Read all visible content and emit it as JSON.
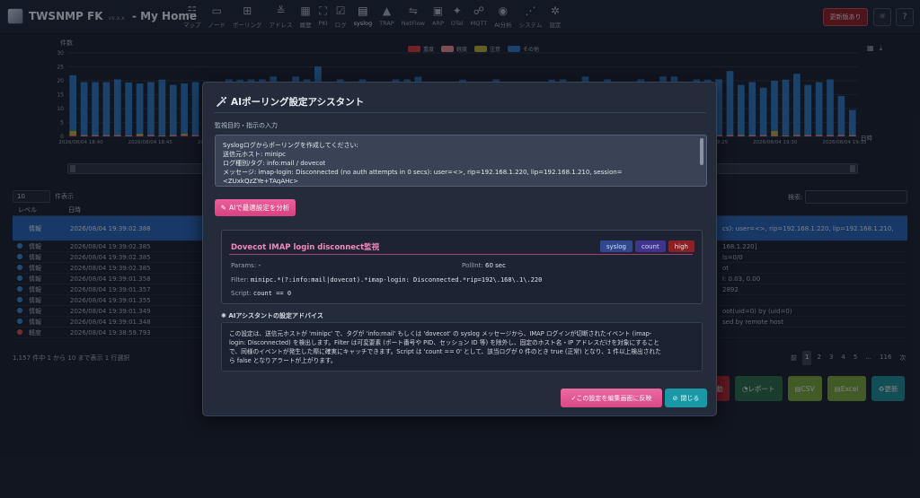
{
  "app": {
    "title": "TWSNMP FK",
    "version": "vx.x.x",
    "page": "- My Home"
  },
  "nav": [
    {
      "icon": "☷",
      "label": "マップ"
    },
    {
      "icon": "▭",
      "label": "ノード"
    },
    {
      "icon": "⊞",
      "label": "ポーリング"
    },
    {
      "icon": "≚",
      "label": "アドレス"
    },
    {
      "icon": "▦",
      "label": "履歴"
    },
    {
      "icon": "⛶",
      "label": "PKI"
    },
    {
      "icon": "☑",
      "label": "ログ"
    },
    {
      "icon": "▤",
      "label": "syslog"
    },
    {
      "icon": "▲",
      "label": "TRAP"
    },
    {
      "icon": "⇋",
      "label": "NetFlow"
    },
    {
      "icon": "▣",
      "label": "ARP"
    },
    {
      "icon": "✦",
      "label": "OTel"
    },
    {
      "icon": "☍",
      "label": "MQTT"
    },
    {
      "icon": "◉",
      "label": "AI分析"
    },
    {
      "icon": "⋰",
      "label": "システム"
    },
    {
      "icon": "✲",
      "label": "設定"
    }
  ],
  "header": {
    "update_label": "更新版あり",
    "theme_icon": "☼",
    "help_icon": "?"
  },
  "chart_data": {
    "type": "bar",
    "ylabel": "件数",
    "xlabel": "日時",
    "ylim": [
      0,
      30
    ],
    "yticks": [
      0,
      5,
      10,
      15,
      20,
      25,
      30
    ],
    "stacked": true,
    "legend": [
      "重度",
      "軽度",
      "注意",
      "その他"
    ],
    "legend_colors": [
      "#d9363e",
      "#e88a92",
      "#b6b035",
      "#2f78c0"
    ],
    "x_tick_labels": [
      "2026/08/04 18:40",
      "2026/08/04 18:45",
      "2026/08/04 18:50",
      "2026/08/04 18:55",
      "2026/08/04 19:00",
      "2026/08/04 19:05",
      "2026/08/04 19:10",
      "2026/08/04 19:15",
      "2026/08/04 19:20",
      "2026/08/04 19:25",
      "2026/08/04 19:30",
      "2026/08/04 19:35"
    ],
    "series": [
      {
        "name": "重度",
        "values": [
          0.2,
          0,
          0,
          0,
          0,
          0,
          0,
          0,
          0,
          0,
          0.2,
          0,
          0,
          0,
          0,
          0,
          0,
          0,
          0,
          0,
          0,
          0,
          0.2,
          0,
          0,
          0,
          0,
          0,
          0,
          0,
          0,
          0,
          0,
          0,
          0,
          0,
          0,
          0,
          0,
          0,
          0,
          0,
          0,
          0,
          0,
          0,
          0,
          0,
          0,
          0,
          0,
          0,
          0,
          0,
          0,
          0,
          0,
          0,
          0,
          0,
          0,
          0,
          0,
          0,
          0,
          0,
          0,
          0,
          0,
          0,
          0
        ]
      },
      {
        "name": "軽度",
        "values": [
          0.3,
          0.5,
          0.5,
          0.5,
          0.5,
          0.4,
          0.5,
          0.5,
          0.4,
          0.5,
          0.3,
          0.5,
          0.5,
          0.4,
          0.5,
          0.4,
          0.5,
          0.5,
          0.5,
          0.5,
          0.5,
          0.5,
          0.4,
          0.5,
          0.5,
          0.4,
          0.5,
          0.5,
          0.4,
          0.5,
          0.5,
          0.4,
          0.5,
          0.5,
          0.5,
          0.4,
          0.5,
          0.5,
          0.5,
          0.4,
          0.5,
          0.5,
          0.5,
          0.4,
          0.5,
          0.5,
          0.5,
          0.4,
          0.5,
          0.5,
          0.5,
          0.5,
          0.4,
          0.5,
          0.5,
          0.5,
          0.5,
          0.4,
          0.5,
          0.5,
          0.5,
          0.5,
          0.5,
          0.5,
          0.4,
          0.5,
          0.5,
          0.5,
          0.5,
          0.5,
          0.5
        ]
      },
      {
        "name": "注意",
        "values": [
          1.5,
          0,
          0,
          0,
          0,
          0,
          0.5,
          0,
          0,
          0,
          0.5,
          0,
          0,
          0,
          0,
          0,
          0,
          0,
          0,
          0,
          0,
          0,
          0.5,
          0,
          0,
          0,
          0,
          0,
          0,
          0,
          0,
          0,
          0,
          0,
          0,
          0,
          0,
          0,
          0,
          0,
          0,
          0,
          0,
          0,
          0,
          0,
          0,
          0,
          0,
          0,
          0,
          0,
          0,
          0,
          0,
          0,
          0,
          0,
          0,
          0,
          0,
          0,
          0,
          1.5,
          0,
          0,
          0,
          0,
          0,
          0,
          0
        ]
      },
      {
        "name": "その他",
        "values": [
          20,
          19,
          19,
          19,
          20,
          19,
          18,
          19,
          20,
          18,
          18,
          19,
          19,
          18,
          20,
          20,
          20,
          20,
          21,
          19,
          21,
          20,
          24,
          18,
          20,
          18,
          20,
          18,
          18,
          20,
          20,
          21,
          19,
          18,
          19,
          20,
          19,
          18,
          20,
          17,
          18,
          18,
          18,
          20,
          20,
          17,
          21,
          19,
          20,
          18,
          19,
          20,
          19,
          21,
          21,
          19,
          20,
          20,
          20,
          23,
          18,
          19,
          17,
          18,
          20,
          22,
          18,
          19,
          20,
          14,
          9
        ]
      }
    ]
  },
  "chart_tools": {
    "zoom_icon": "▦",
    "download_icon": "⤓"
  },
  "table": {
    "page_size": "10",
    "page_size_suffix": "件表示",
    "search_label": "検索:",
    "headers": {
      "level": "レベル",
      "time": "日時"
    },
    "rows": [
      {
        "level": "情報",
        "time": "2026/08/04 19:39:02.388",
        "right": "cs): user=<>, rip=192.168.1.220, lip=192.168.1.210,",
        "type": "info"
      },
      {
        "level": "情報",
        "time": "2026/08/04 19:39:02.385",
        "right": "168.1.220]",
        "type": "info"
      },
      {
        "level": "情報",
        "time": "2026/08/04 19:39:02.385",
        "right": "ls=0/0",
        "type": "info"
      },
      {
        "level": "情報",
        "time": "2026/08/04 19:39:02.385",
        "right": "ot",
        "type": "info"
      },
      {
        "level": "情報",
        "time": "2026/08/04 19:39:01.358",
        "right": "l: 0.03, 0.00",
        "type": "info"
      },
      {
        "level": "情報",
        "time": "2026/08/04 19:39:01.357",
        "right": "2892",
        "type": "info"
      },
      {
        "level": "情報",
        "time": "2026/08/04 19:39:01.355",
        "right": "",
        "type": "info"
      },
      {
        "level": "情報",
        "time": "2026/08/04 19:39:01.349",
        "right": "oot(uid=0) by (uid=0)",
        "type": "info"
      },
      {
        "level": "情報",
        "time": "2026/08/04 19:39:01.348",
        "right": "sed by remote host",
        "type": "info"
      },
      {
        "level": "軽度",
        "time": "2026/08/04 19:38:59.793",
        "right": "",
        "type": "warn"
      }
    ],
    "footer_info": "1,157 件中 1 から 10 まで表示 1 行選択",
    "pager": [
      "前",
      "1",
      "2",
      "3",
      "4",
      "5",
      "...",
      "116",
      "次"
    ]
  },
  "bottom_buttons": [
    {
      "icon": "",
      "label": "動"
    },
    {
      "icon": "◔",
      "label": "レポート"
    },
    {
      "icon": "▤",
      "label": "CSV"
    },
    {
      "icon": "▤",
      "label": "Excel"
    },
    {
      "icon": "♻",
      "label": "更新"
    }
  ],
  "bottom_button_colors": [
    "#b6282f",
    "#2f6d4e",
    "#7aa63a",
    "#7aa63a",
    "#1f8d98"
  ],
  "modal": {
    "title": "AIポーリング設定アシスタント",
    "input_label": "監視目的・指示の入力",
    "prompt_lines": [
      "Syslogログからポーリングを作成してください:",
      "送信元ホスト: minipc",
      "ログ種別/タグ: info:mail / dovecot",
      "メッセージ: imap-login: Disconnected (no auth attempts in 0 secs): user=<>, rip=192.168.1.220, lip=192.168.1.210, session=",
      "<ZUxkQzZYe+TAqAHc>"
    ],
    "analyze_label": "AIで最適設定を分析",
    "rule": {
      "name": "Dovecot IMAP login disconnect監視",
      "tags": [
        "syslog",
        "count",
        "high"
      ],
      "params_label": "Params:",
      "params_value": "-",
      "pollint_label": "PollInt:",
      "pollint_value": "60 sec",
      "filter_label": "Filter:",
      "filter_value": "minipc.*(?:info:mail|dovecot).*imap-login: Disconnected.*rip=192\\.168\\.1\\.220",
      "script_label": "Script:",
      "script_value": "count == 0"
    },
    "advice_label": "AIアシスタントの設定アドバイス",
    "advice_lines": [
      "この設定は、送信元ホストが 'minipc' で、タグが 'info:mail' もしくは 'dovecot' の syslog メッセージから、IMAP ログインが切断されたイベント (imap-",
      "login: Disconnected) を検出します。Filter は可変要素 (ポート番号や PID、セッション ID 等) を除外し、固定のホスト名・IP アドレスだけを対象にすること",
      "で、同様のイベントが発生した際に確実にキャッチできます。Script は 'count == 0' として、該当ログが 0 件のとき true (正常) となり、1 件以上検出された",
      "ら false となりアラートが上がります。"
    ],
    "apply_label": "この設定を編集画面に反映",
    "close_label": "閉じる"
  }
}
